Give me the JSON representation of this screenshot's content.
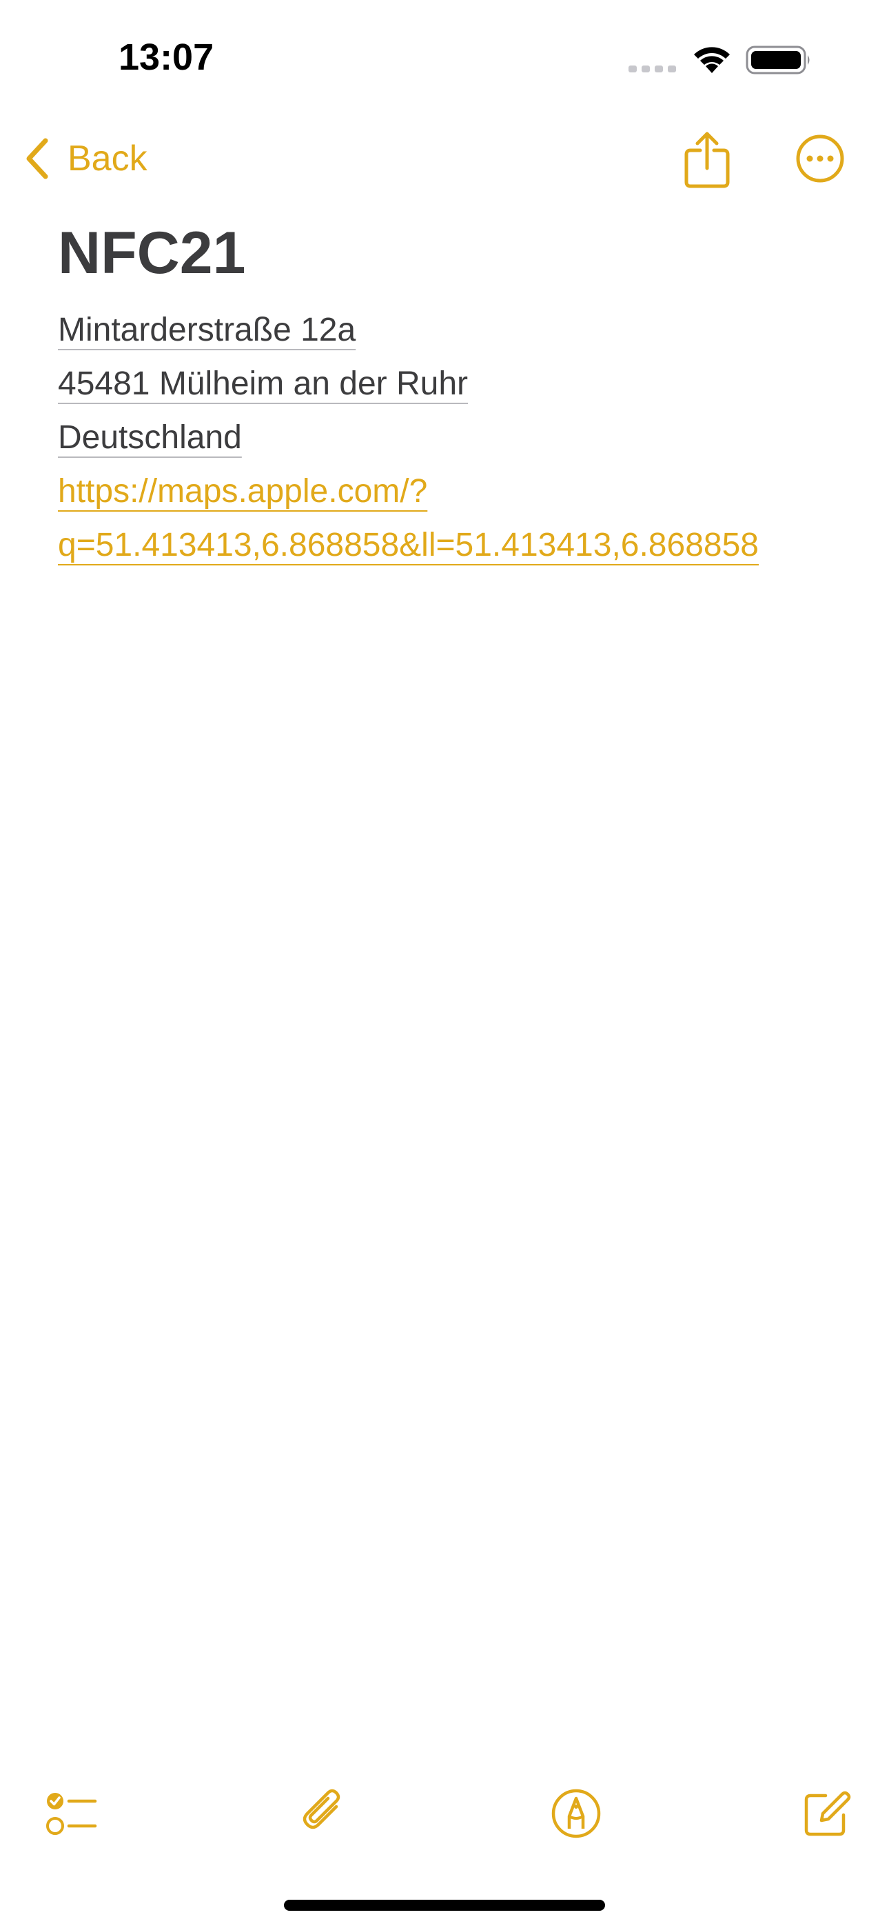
{
  "status_bar": {
    "time": "13:07",
    "signal_icon": "cellular-signal-icon",
    "wifi_icon": "wifi-icon",
    "battery_icon": "battery-icon"
  },
  "nav": {
    "back_label": "Back",
    "back_icon": "chevron-left-icon",
    "share_icon": "share-icon",
    "more_icon": "ellipsis-circle-icon"
  },
  "note": {
    "title": "NFC21",
    "address_line1": "Mintarderstraße 12a",
    "address_line2": "45481 Mülheim an der Ruhr",
    "address_line3": "Deutschland",
    "url_line1": "https://maps.apple.com/?",
    "url_line2": "q=51.413413,6.868858&ll=51.413413,6.868858"
  },
  "toolbar": {
    "checklist_icon": "checklist-icon",
    "attachment_icon": "paperclip-icon",
    "markup_icon": "markup-pen-icon",
    "compose_icon": "compose-icon"
  },
  "colors": {
    "accent": "#e1a91a",
    "text": "#3c3c3e",
    "background": "#ffffff"
  }
}
